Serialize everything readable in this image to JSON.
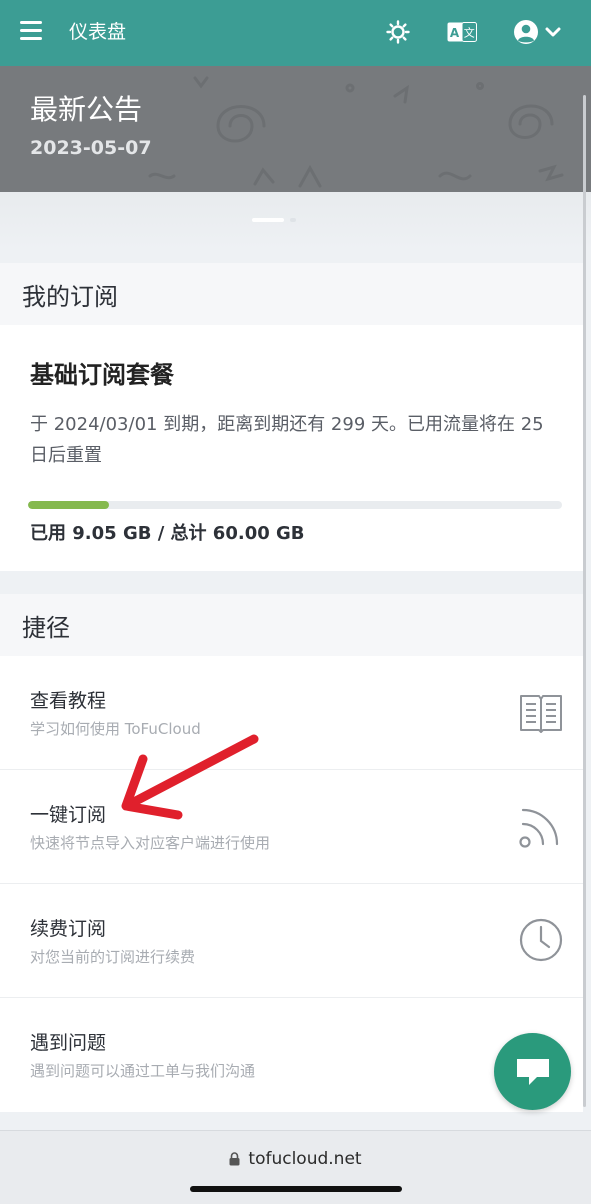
{
  "topbar": {
    "title": "仪表盘",
    "icons": [
      "menu-icon",
      "sun-icon",
      "translate-icon",
      "user-icon",
      "chevron-down-icon"
    ],
    "color": "#3c9d94"
  },
  "announcement": {
    "title": "最新公告",
    "date": "2023-05-07"
  },
  "subscription": {
    "header": "我的订阅",
    "plan_name": "基础订阅套餐",
    "description": "于 2024/03/01 到期，距离到期还有 299 天。已用流量将在 25 日后重置",
    "usage_text": "已用 9.05 GB / 总计 60.00 GB",
    "usage_fraction": 0.151,
    "progress_color": "#85b94e"
  },
  "shortcuts": {
    "header": "捷径",
    "items": [
      {
        "title": "查看教程",
        "desc": "学习如何使用 ToFuCloud",
        "icon": "book-icon"
      },
      {
        "title": "一键订阅",
        "desc": "快速将节点导入对应客户端进行使用",
        "icon": "rss-icon"
      },
      {
        "title": "续费订阅",
        "desc": "对您当前的订阅进行续费",
        "icon": "clock-icon"
      },
      {
        "title": "遇到问题",
        "desc": "遇到问题可以通过工单与我们沟通",
        "icon": "chat-icon"
      }
    ]
  },
  "browser": {
    "url": "tofucloud.net"
  },
  "colors": {
    "fab": "#2a9a7c",
    "arrow": "#e0202c"
  }
}
